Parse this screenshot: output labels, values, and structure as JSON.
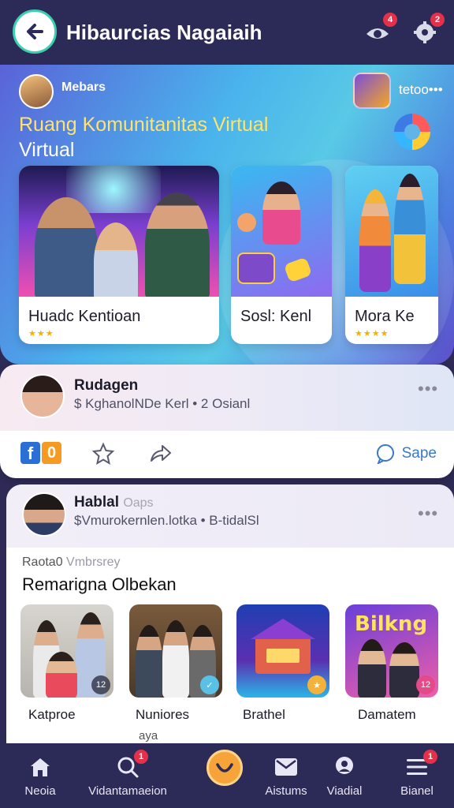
{
  "header": {
    "title": "Hibaurcias Nagaiaih",
    "notif_badge": "4",
    "settings_badge": "2"
  },
  "hero": {
    "user_name": "Mebars",
    "more_text": "tetoo•••",
    "title_line1": "Ruang Komunitanitas Virtual",
    "title_line2": "Virtual",
    "cards": [
      {
        "label": "Huadc Kentioan",
        "stars": "★★★"
      },
      {
        "label": "Sosl: Kenl"
      },
      {
        "label": "Mora Ke",
        "stars": "★★★★"
      }
    ]
  },
  "post1": {
    "name": "Rudagen",
    "subtitle": "$ KghanolNDe Kerl • 2 Osianl",
    "more": "•••",
    "share_label": "Sape"
  },
  "post2": {
    "name": "Hablal",
    "name_faint": "Oaps",
    "subtitle": "$Vmurokernlen.lotka • B-tidalSl",
    "more": "•••",
    "section_small": "Raota0",
    "section_small_faint": "Vmbrsrey",
    "section_title": "Remarigna Olbekan",
    "tiles": [
      {
        "label": "Katproe",
        "badge": "12"
      },
      {
        "label": "Nuniores",
        "badge": ""
      },
      {
        "label": "Brathel",
        "badge": ""
      },
      {
        "label": "Damatem",
        "badge": "12"
      }
    ],
    "tile_banner": "Bilkng",
    "peek_text": "aya"
  },
  "bottom_nav": {
    "items": [
      {
        "label": "Neoia"
      },
      {
        "label": "Vidantamaeion",
        "badge": "1"
      },
      {
        "label": "Aistums"
      },
      {
        "label": "Viadial"
      },
      {
        "label": "Bianel",
        "badge": "1"
      }
    ]
  },
  "colors": {
    "accent_teal": "#3ccfae",
    "nav_bg": "#2c2a57",
    "badge_red": "#e5304a",
    "hero_title_yellow": "#ffe36b",
    "link_blue": "#3a78c8"
  },
  "icons": [
    "back-arrow-icon",
    "eye-icon",
    "gear-icon",
    "swirl-logo-icon",
    "facebook-icon",
    "star-icon",
    "share-icon",
    "chat-icon",
    "home-icon",
    "search-icon",
    "center-icon",
    "mail-icon",
    "profile-icon",
    "menu-icon"
  ]
}
